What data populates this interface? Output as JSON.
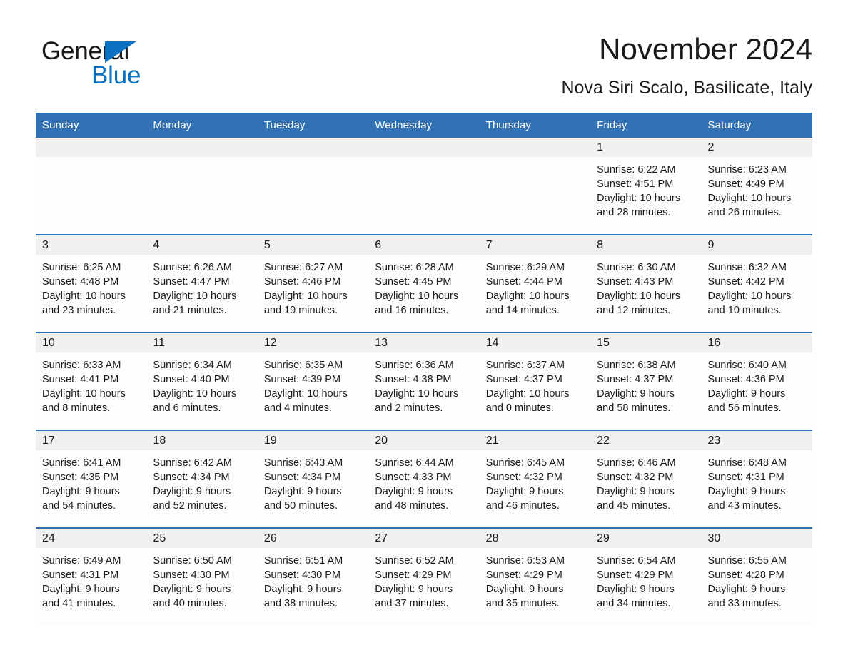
{
  "brand": {
    "word1": "General",
    "word2": "Blue",
    "triangle_color": "#0a72c0"
  },
  "header": {
    "month_title": "November 2024",
    "location": "Nova Siri Scalo, Basilicate, Italy"
  },
  "theme": {
    "header_blue": "#3272b4",
    "row_separator_blue": "#3272b4",
    "daynum_band_gray": "#f0f0f0",
    "text_color": "#1a1a1a"
  },
  "weekday_headers": [
    "Sunday",
    "Monday",
    "Tuesday",
    "Wednesday",
    "Thursday",
    "Friday",
    "Saturday"
  ],
  "weeks": [
    [
      {
        "day": "",
        "sunrise": "",
        "sunset": "",
        "daylight_l1": "",
        "daylight_l2": ""
      },
      {
        "day": "",
        "sunrise": "",
        "sunset": "",
        "daylight_l1": "",
        "daylight_l2": ""
      },
      {
        "day": "",
        "sunrise": "",
        "sunset": "",
        "daylight_l1": "",
        "daylight_l2": ""
      },
      {
        "day": "",
        "sunrise": "",
        "sunset": "",
        "daylight_l1": "",
        "daylight_l2": ""
      },
      {
        "day": "",
        "sunrise": "",
        "sunset": "",
        "daylight_l1": "",
        "daylight_l2": ""
      },
      {
        "day": "1",
        "sunrise": "Sunrise: 6:22 AM",
        "sunset": "Sunset: 4:51 PM",
        "daylight_l1": "Daylight: 10 hours",
        "daylight_l2": "and 28 minutes."
      },
      {
        "day": "2",
        "sunrise": "Sunrise: 6:23 AM",
        "sunset": "Sunset: 4:49 PM",
        "daylight_l1": "Daylight: 10 hours",
        "daylight_l2": "and 26 minutes."
      }
    ],
    [
      {
        "day": "3",
        "sunrise": "Sunrise: 6:25 AM",
        "sunset": "Sunset: 4:48 PM",
        "daylight_l1": "Daylight: 10 hours",
        "daylight_l2": "and 23 minutes."
      },
      {
        "day": "4",
        "sunrise": "Sunrise: 6:26 AM",
        "sunset": "Sunset: 4:47 PM",
        "daylight_l1": "Daylight: 10 hours",
        "daylight_l2": "and 21 minutes."
      },
      {
        "day": "5",
        "sunrise": "Sunrise: 6:27 AM",
        "sunset": "Sunset: 4:46 PM",
        "daylight_l1": "Daylight: 10 hours",
        "daylight_l2": "and 19 minutes."
      },
      {
        "day": "6",
        "sunrise": "Sunrise: 6:28 AM",
        "sunset": "Sunset: 4:45 PM",
        "daylight_l1": "Daylight: 10 hours",
        "daylight_l2": "and 16 minutes."
      },
      {
        "day": "7",
        "sunrise": "Sunrise: 6:29 AM",
        "sunset": "Sunset: 4:44 PM",
        "daylight_l1": "Daylight: 10 hours",
        "daylight_l2": "and 14 minutes."
      },
      {
        "day": "8",
        "sunrise": "Sunrise: 6:30 AM",
        "sunset": "Sunset: 4:43 PM",
        "daylight_l1": "Daylight: 10 hours",
        "daylight_l2": "and 12 minutes."
      },
      {
        "day": "9",
        "sunrise": "Sunrise: 6:32 AM",
        "sunset": "Sunset: 4:42 PM",
        "daylight_l1": "Daylight: 10 hours",
        "daylight_l2": "and 10 minutes."
      }
    ],
    [
      {
        "day": "10",
        "sunrise": "Sunrise: 6:33 AM",
        "sunset": "Sunset: 4:41 PM",
        "daylight_l1": "Daylight: 10 hours",
        "daylight_l2": "and 8 minutes."
      },
      {
        "day": "11",
        "sunrise": "Sunrise: 6:34 AM",
        "sunset": "Sunset: 4:40 PM",
        "daylight_l1": "Daylight: 10 hours",
        "daylight_l2": "and 6 minutes."
      },
      {
        "day": "12",
        "sunrise": "Sunrise: 6:35 AM",
        "sunset": "Sunset: 4:39 PM",
        "daylight_l1": "Daylight: 10 hours",
        "daylight_l2": "and 4 minutes."
      },
      {
        "day": "13",
        "sunrise": "Sunrise: 6:36 AM",
        "sunset": "Sunset: 4:38 PM",
        "daylight_l1": "Daylight: 10 hours",
        "daylight_l2": "and 2 minutes."
      },
      {
        "day": "14",
        "sunrise": "Sunrise: 6:37 AM",
        "sunset": "Sunset: 4:37 PM",
        "daylight_l1": "Daylight: 10 hours",
        "daylight_l2": "and 0 minutes."
      },
      {
        "day": "15",
        "sunrise": "Sunrise: 6:38 AM",
        "sunset": "Sunset: 4:37 PM",
        "daylight_l1": "Daylight: 9 hours",
        "daylight_l2": "and 58 minutes."
      },
      {
        "day": "16",
        "sunrise": "Sunrise: 6:40 AM",
        "sunset": "Sunset: 4:36 PM",
        "daylight_l1": "Daylight: 9 hours",
        "daylight_l2": "and 56 minutes."
      }
    ],
    [
      {
        "day": "17",
        "sunrise": "Sunrise: 6:41 AM",
        "sunset": "Sunset: 4:35 PM",
        "daylight_l1": "Daylight: 9 hours",
        "daylight_l2": "and 54 minutes."
      },
      {
        "day": "18",
        "sunrise": "Sunrise: 6:42 AM",
        "sunset": "Sunset: 4:34 PM",
        "daylight_l1": "Daylight: 9 hours",
        "daylight_l2": "and 52 minutes."
      },
      {
        "day": "19",
        "sunrise": "Sunrise: 6:43 AM",
        "sunset": "Sunset: 4:34 PM",
        "daylight_l1": "Daylight: 9 hours",
        "daylight_l2": "and 50 minutes."
      },
      {
        "day": "20",
        "sunrise": "Sunrise: 6:44 AM",
        "sunset": "Sunset: 4:33 PM",
        "daylight_l1": "Daylight: 9 hours",
        "daylight_l2": "and 48 minutes."
      },
      {
        "day": "21",
        "sunrise": "Sunrise: 6:45 AM",
        "sunset": "Sunset: 4:32 PM",
        "daylight_l1": "Daylight: 9 hours",
        "daylight_l2": "and 46 minutes."
      },
      {
        "day": "22",
        "sunrise": "Sunrise: 6:46 AM",
        "sunset": "Sunset: 4:32 PM",
        "daylight_l1": "Daylight: 9 hours",
        "daylight_l2": "and 45 minutes."
      },
      {
        "day": "23",
        "sunrise": "Sunrise: 6:48 AM",
        "sunset": "Sunset: 4:31 PM",
        "daylight_l1": "Daylight: 9 hours",
        "daylight_l2": "and 43 minutes."
      }
    ],
    [
      {
        "day": "24",
        "sunrise": "Sunrise: 6:49 AM",
        "sunset": "Sunset: 4:31 PM",
        "daylight_l1": "Daylight: 9 hours",
        "daylight_l2": "and 41 minutes."
      },
      {
        "day": "25",
        "sunrise": "Sunrise: 6:50 AM",
        "sunset": "Sunset: 4:30 PM",
        "daylight_l1": "Daylight: 9 hours",
        "daylight_l2": "and 40 minutes."
      },
      {
        "day": "26",
        "sunrise": "Sunrise: 6:51 AM",
        "sunset": "Sunset: 4:30 PM",
        "daylight_l1": "Daylight: 9 hours",
        "daylight_l2": "and 38 minutes."
      },
      {
        "day": "27",
        "sunrise": "Sunrise: 6:52 AM",
        "sunset": "Sunset: 4:29 PM",
        "daylight_l1": "Daylight: 9 hours",
        "daylight_l2": "and 37 minutes."
      },
      {
        "day": "28",
        "sunrise": "Sunrise: 6:53 AM",
        "sunset": "Sunset: 4:29 PM",
        "daylight_l1": "Daylight: 9 hours",
        "daylight_l2": "and 35 minutes."
      },
      {
        "day": "29",
        "sunrise": "Sunrise: 6:54 AM",
        "sunset": "Sunset: 4:29 PM",
        "daylight_l1": "Daylight: 9 hours",
        "daylight_l2": "and 34 minutes."
      },
      {
        "day": "30",
        "sunrise": "Sunrise: 6:55 AM",
        "sunset": "Sunset: 4:28 PM",
        "daylight_l1": "Daylight: 9 hours",
        "daylight_l2": "and 33 minutes."
      }
    ]
  ]
}
